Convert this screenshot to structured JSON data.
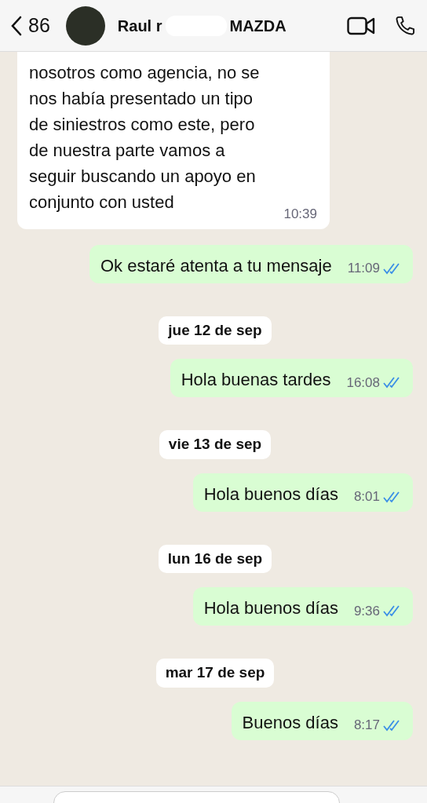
{
  "header": {
    "back_count": "86",
    "contact_name_start": "Raul r",
    "contact_name_end": "MAZDA"
  },
  "messages": [
    {
      "kind": "incoming",
      "text": "nosotros como agencia, no se\nnos había presentado un tipo\nde siniestros como este, pero\nde nuestra parte vamos a\nseguir buscando un apoyo en\nconjunto con usted",
      "time": "10:39",
      "read": false
    },
    {
      "kind": "outgoing",
      "text": "Ok estaré atenta a tu mensaje",
      "time": "11:09",
      "read": true
    },
    {
      "kind": "date",
      "text": "jue 12 de sep"
    },
    {
      "kind": "outgoing",
      "text": "Hola buenas tardes",
      "time": "16:08",
      "read": true
    },
    {
      "kind": "date",
      "text": "vie 13 de sep"
    },
    {
      "kind": "outgoing",
      "text": "Hola buenos días",
      "time": "8:01",
      "read": true
    },
    {
      "kind": "date",
      "text": "lun 16 de sep"
    },
    {
      "kind": "outgoing",
      "text": "Hola buenos días",
      "time": "9:36",
      "read": true
    },
    {
      "kind": "date",
      "text": "mar 17 de sep"
    },
    {
      "kind": "outgoing",
      "text": "Buenos días",
      "time": "8:17",
      "read": true
    }
  ]
}
